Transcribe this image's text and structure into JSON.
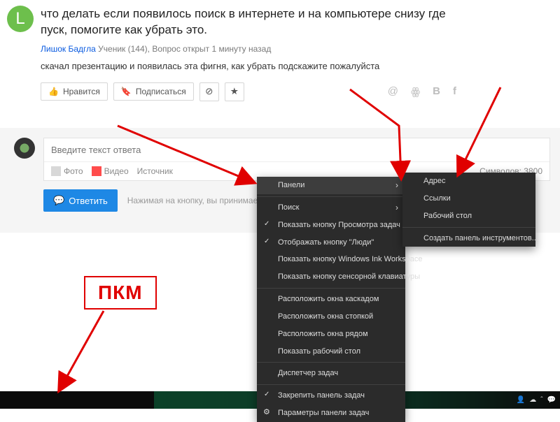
{
  "question": {
    "avatar_letter": "L",
    "title": "что делать если появилось поиск в интернете и на компьютере снизу где пуск, помогите как убрать это.",
    "author_link": "Лишок Бадгла",
    "author_rank": "Ученик (144)",
    "status": "Вопрос открыт 1 минуту назад",
    "body": "скачал презентацию и появилась эта фигня, как убрать подскажите пожалуйста",
    "like_label": "Нравится",
    "subscribe_label": "Подписаться"
  },
  "answer": {
    "placeholder": "Введите текст ответа",
    "photo_label": "Фото",
    "video_label": "Видео",
    "source_label": "Источник",
    "chars_label": "Символов:",
    "chars_value": "3800",
    "submit_label": "Ответить",
    "tos_text": "Нажимая на кнопку, вы принимаете ус"
  },
  "context_menu": {
    "panels": "Панели",
    "search": "Поиск",
    "show_taskview": "Показать кнопку Просмотра задач",
    "show_people": "Отображать кнопку \"Люди\"",
    "show_ink": "Показать кнопку Windows Ink Workspace",
    "show_touchkb": "Показать кнопку сенсорной клавиатуры",
    "cascade": "Расположить окна каскадом",
    "stack": "Расположить окна стопкой",
    "sidebyside": "Расположить окна рядом",
    "show_desktop": "Показать рабочий стол",
    "taskmgr": "Диспетчер задач",
    "lock_taskbar": "Закрепить панель задач",
    "settings": "Параметры панели задач"
  },
  "submenu": {
    "address": "Адрес",
    "links": "Ссылки",
    "desktop": "Рабочий стол",
    "new_toolbar": "Создать панель инструментов..."
  },
  "annotation": {
    "pkm": "ПКМ"
  }
}
